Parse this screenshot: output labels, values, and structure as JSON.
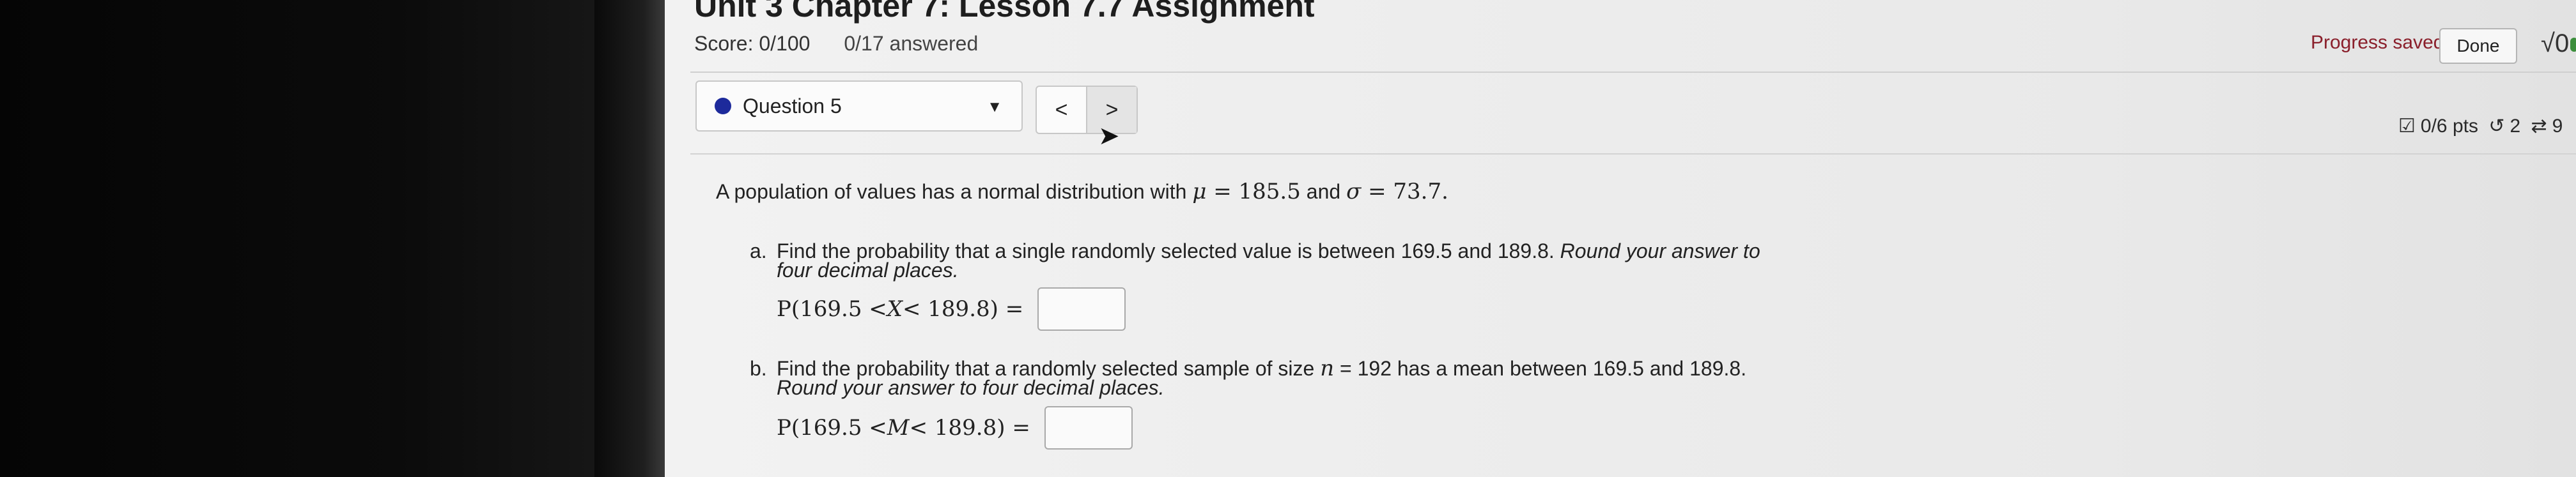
{
  "header": {
    "title": "Unit 3 Chapter 7: Lesson 7.7 Assignment",
    "score": "Score: 0/100",
    "answered": "0/17 answered",
    "progress_saved": "Progress saved",
    "done_label": "Done",
    "math_tool": "√0"
  },
  "toolbar": {
    "question_label": "Question 5",
    "prev_label": "<",
    "next_label": ">",
    "points": "0/6 pts",
    "retries": "2",
    "attempts": "9"
  },
  "question": {
    "intro_prefix": "A population of values has a normal distribution with ",
    "mu_symbol": "μ",
    "mu_value": " = 185.5",
    "and_word": " and ",
    "sigma_symbol": "σ",
    "sigma_value": " = 73.7.",
    "part_a": {
      "letter": "a.",
      "text": "Find the probability that a single randomly selected value is between 169.5 and 189.8.",
      "instruction": "Round your answer to four decimal places.",
      "eq_prefix": "P(169.5 < ",
      "eq_var": "X",
      "eq_suffix": " < 189.8) ="
    },
    "part_b": {
      "letter": "b.",
      "text_before_n": "Find the probability that a randomly selected sample of size ",
      "n_symbol": "n",
      "text_after_n": " = 192 has a mean between 169.5 and 189.8.",
      "instruction": "Round your answer to four decimal places.",
      "eq_prefix": "P(169.5 < ",
      "eq_var": "M",
      "eq_suffix": " < 189.8) ="
    }
  },
  "colors": {
    "progress_saved": "#8a1f2b",
    "question_dot": "#1d2a9b"
  }
}
